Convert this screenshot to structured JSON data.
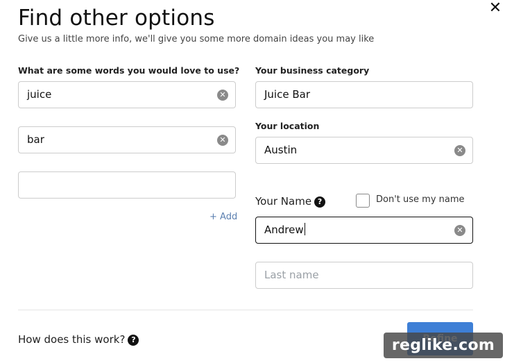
{
  "header": {
    "title": "Find other options",
    "subtitle": "Give us a little more info, we'll give you some more domain ideas you may like",
    "close_glyph": "✕"
  },
  "keywords": {
    "label": "What are some words you would love to use?",
    "fields": [
      {
        "value": "juice"
      },
      {
        "value": "bar"
      },
      {
        "value": ""
      }
    ],
    "add_label": "+ Add"
  },
  "business": {
    "category_label": "Your business category",
    "category_value": "Juice Bar",
    "location_label": "Your location",
    "location_value": "Austin"
  },
  "name": {
    "label": "Your Name",
    "dont_use_label": "Don't use my name",
    "first_value": "Andrew",
    "last_placeholder": "Last name"
  },
  "footer": {
    "how_label": "How does this work?",
    "refine_label": "Refine"
  },
  "watermark": "reglike.com",
  "icons": {
    "clear": "clear-x-circle-icon",
    "help": "question-circle-icon",
    "close": "close-icon"
  },
  "colors": {
    "accent": "#3e7fd6",
    "link": "#5b7fb0"
  }
}
